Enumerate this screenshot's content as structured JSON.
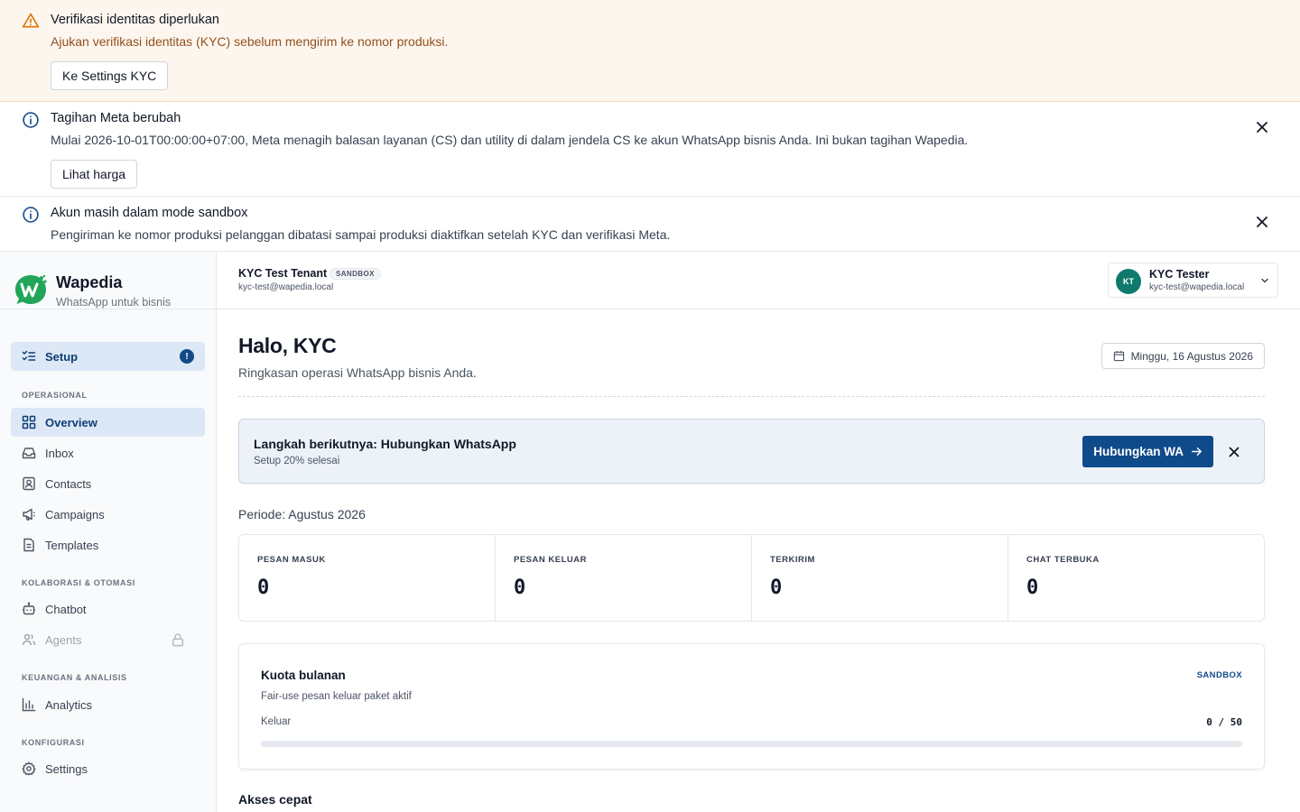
{
  "banners": {
    "kyc": {
      "title": "Verifikasi identitas diperlukan",
      "description": "Ajukan verifikasi identitas (KYC) sebelum mengirim ke nomor produksi.",
      "button": "Ke Settings KYC",
      "icon": "warning-icon",
      "color": "#d97706"
    },
    "meta": {
      "title": "Tagihan Meta berubah",
      "description": "Mulai 2026-10-01T00:00:00+07:00, Meta menagih balasan layanan (CS) dan utility di dalam jendela CS ke akun WhatsApp bisnis Anda. Ini bukan tagihan Wapedia.",
      "button": "Lihat harga",
      "icon": "info-icon"
    },
    "sandbox": {
      "title": "Akun masih dalam mode sandbox",
      "description": "Pengiriman ke nomor produksi pelanggan dibatasi sampai produksi diaktifkan setelah KYC dan verifikasi Meta.",
      "icon": "info-icon"
    }
  },
  "brand": {
    "name": "Wapedia",
    "tagline": "WhatsApp untuk bisnis"
  },
  "sidebar": {
    "setup": {
      "label": "Setup",
      "badge": "!"
    },
    "sections": [
      {
        "title": "OPERASIONAL",
        "items": [
          "Overview",
          "Inbox",
          "Contacts",
          "Campaigns",
          "Templates"
        ]
      },
      {
        "title": "KOLABORASI & OTOMASI",
        "items": [
          "Chatbot",
          "Agents"
        ]
      },
      {
        "title": "KEUANGAN & ANALISIS",
        "items": [
          "Analytics"
        ]
      },
      {
        "title": "KONFIGURASI",
        "items": [
          "Settings"
        ]
      }
    ]
  },
  "topbar": {
    "tenant": "KYC Test Tenant",
    "env": "SANDBOX",
    "tenant_email": "kyc-test@wapedia.local",
    "user": {
      "initials": "KT",
      "name": "KYC Tester",
      "email": "kyc-test@wapedia.local"
    }
  },
  "main": {
    "greeting": "Halo, KYC",
    "subtitle": "Ringkasan operasi WhatsApp bisnis Anda.",
    "date": "Minggu, 16 Agustus 2026",
    "next_step": {
      "title": "Langkah berikutnya: Hubungkan WhatsApp",
      "subtitle": "Setup 20% selesai",
      "button": "Hubungkan WA"
    },
    "period": "Periode: Agustus 2026",
    "stats": [
      {
        "label": "PESAN MASUK",
        "value": "0"
      },
      {
        "label": "PESAN KELUAR",
        "value": "0"
      },
      {
        "label": "TERKIRIM",
        "value": "0"
      },
      {
        "label": "CHAT TERBUKA",
        "value": "0"
      }
    ],
    "quota": {
      "title": "Kuota bulanan",
      "tag": "SANDBOX",
      "subtitle": "Fair-use pesan keluar paket aktif",
      "label": "Keluar",
      "value": "0 / 50",
      "used_fraction": 0
    },
    "quick_access": "Akses cepat"
  },
  "colors": {
    "primary": "#0f4a8a",
    "brand_green": "#22a559",
    "avatar": "#0f7a6c"
  }
}
